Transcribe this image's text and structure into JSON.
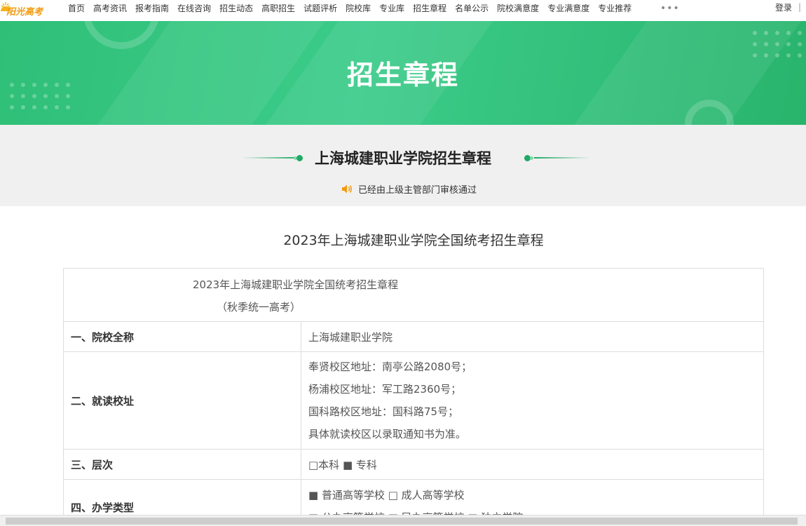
{
  "header": {
    "logo_text": "阳光高考",
    "nav": [
      "首页",
      "高考资讯",
      "报考指南",
      "在线咨询",
      "招生动态",
      "高职招生",
      "试题评析",
      "院校库",
      "专业库",
      "招生章程",
      "名单公示",
      "院校满意度",
      "专业满意度",
      "专业推荐"
    ],
    "more": "•••",
    "login": "登录",
    "login_sep": "|"
  },
  "banner": {
    "title": "招生章程"
  },
  "section": {
    "title": "上海城建职业学院招生章程",
    "audit_text": "已经由上级主管部门审核通过"
  },
  "document": {
    "title": "2023年上海城建职业学院全国统考招生章程",
    "header_line1": "2023年上海城建职业学院全国统考招生章程",
    "header_line2": "（秋季统一高考）",
    "rows": [
      {
        "label": "一、院校全称",
        "lines": [
          "上海城建职业学院"
        ]
      },
      {
        "label": "二、就读校址",
        "lines": [
          "奉贤校区地址：南亭公路2080号；",
          "杨浦校区地址：军工路2360号；",
          "国科路校区地址：国科路75号；",
          "具体就读校区以录取通知书为准。"
        ]
      },
      {
        "label": "三、层次",
        "lines": [
          "□本科 ■ 专科"
        ]
      },
      {
        "label": "四、办学类型",
        "lines": [
          "■ 普通高等学校 □ 成人高等学校",
          "□ 公办高等学校 □ 民办高等学校 □ 独立学院"
        ]
      }
    ]
  },
  "colors": {
    "accent": "#2fbf77",
    "logo": "#f29b0f"
  }
}
